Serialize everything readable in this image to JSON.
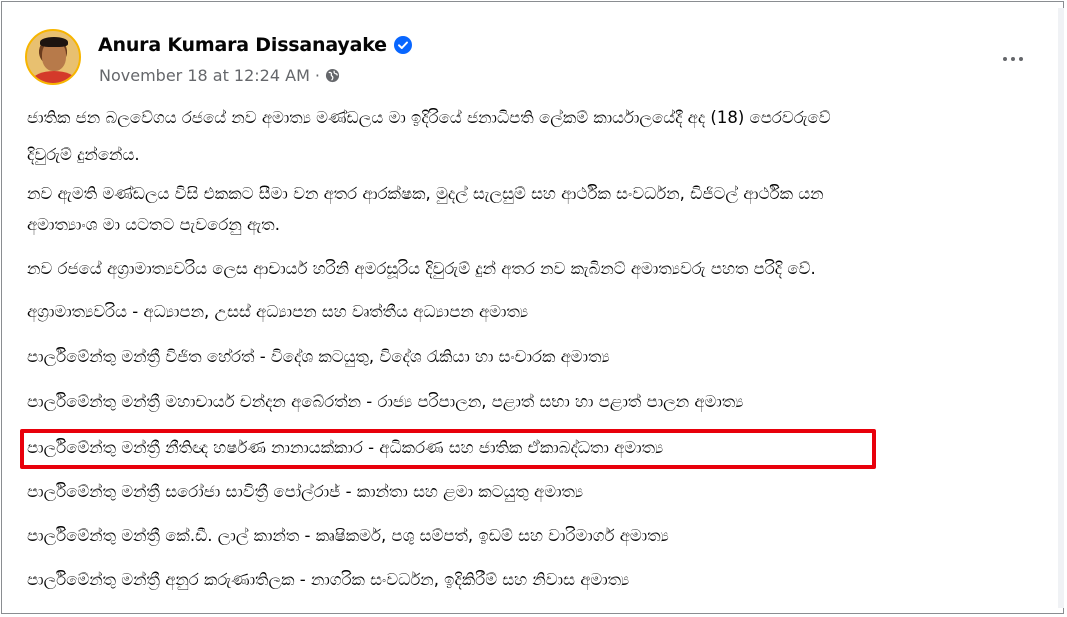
{
  "post": {
    "author": "Anura Kumara Dissanayake",
    "verified": true,
    "timestamp": "November 18 at 12:24 AM",
    "separator": "·",
    "privacy_icon": "globe-icon",
    "more_icon": "more-options-icon",
    "paragraphs": [
      "ජාතික ජන බලවේගය රජයේ නව අමාත්‍ය මණ්ඩලය මා ඉදිරියේ ජනාධිපති ලේකම් කාර්යාලයේදී අද (18) පෙරවරුවේ",
      "දිවුරුම් දුන්නේය.",
      "නව ඇමති මණ්ඩලය විසි එකකට සීමා වන අතර ආරක්ෂක, මුදල්  සැලසුම් සහ ආර්ථික සංවර්ධන, ඩිජිටල් ආර්ථික යන",
      "අමාත්‍යාංශ මා යටතට පැවරෙනු ඇත.",
      "නව රජයේ අග්‍රාමාත්‍යවරිය ලෙස ආචාර්ය හරිනි අමරසූරිය දිවුරුම් දුන් අතර නව කැබිනට් අමාත්‍යවරු පහත පරිදි වේ.",
      "අග්‍රාමාත්‍යවරිය - අධ්‍යාපන, උසස් අධ්‍යාපන සහ වෘත්තීය අධ්‍යාපන අමාත්‍ය",
      "පාර්ලිමේන්තු මන්ත්‍රී විජිත හේරත් - විදේශ කටයුතු, විදේශ රැකියා හා සංචාරක අමාත්‍ය",
      "පාර්ලිමේන්තු මන්ත්‍රී මහාචාර්ය චන්දන අබේරත්න - රාජ්‍ය පරිපාලන, පළාත් සභා හා පළාත් පාලන අමාත්‍ය",
      "පාර්ලිමේන්තු මන්ත්‍රී නීතිඥ හර්ෂණ නානායක්කාර - අධිකරණ සහ ජාතික ඒකාබද්ධතා අමාත්‍ය",
      "පාර්ලිමේන්තු මන්ත්‍රී සරෝජා සාවිත්‍රී පෝල්රාජ් - කාන්තා සහ ළමා කටයුතු අමාත්‍ය",
      "පාර්ලිමේන්තු මන්ත්‍රී කේ.ඩී. ලාල් කාන්ත - කෘෂිකර්ම, පශු සම්පත්, ඉඩම් සහ වාරිමාර්ග අමාත්‍ය",
      "පාර්ලිමේන්තු මන්ත්‍රී අනුර කරුණාතිලක - නාගරික සංවර්ධන, ඉදිකිරීම් සහ නිවාස අමාත්‍ය"
    ]
  },
  "colors": {
    "highlight_border": "#e8000b",
    "verified_badge": "#0866ff",
    "meta_text": "#65676b"
  }
}
